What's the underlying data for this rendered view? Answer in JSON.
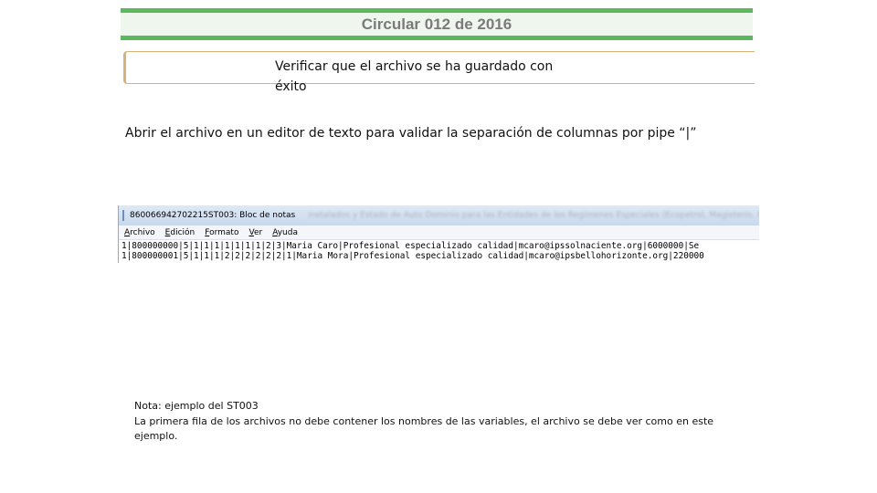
{
  "header": {
    "title": "Circular 012 de 2016"
  },
  "step": {
    "text": "Verificar que el archivo se ha guardado con éxito"
  },
  "instruction": {
    "text": "Abrir el archivo en un editor de texto para  validar la separación de columnas por pipe  “|”"
  },
  "notepad": {
    "window_title": "860066942702215ST003: Bloc de notas",
    "blurred_title": "instalados y Estado de Auto Dominio para las Entidades de los Regímenes Especiales (Ecopetrol, Magisterio, Fuerzas",
    "menu": [
      {
        "hotkey": "A",
        "rest": "rchivo"
      },
      {
        "hotkey": "E",
        "rest": "dición"
      },
      {
        "hotkey": "F",
        "rest": "ormato"
      },
      {
        "hotkey": "V",
        "rest": "er"
      },
      {
        "hotkey": "A",
        "rest": "yuda"
      }
    ],
    "lines": [
      "1|800000000|5|1|1|1|1|1|1|1|2|3|Maria Caro|Profesional especializado calidad|mcaro@ipssolnaciente.org|6000000|Se",
      "1|800000001|5|1|1|1|2|2|2|2|2|2|1|Maria Mora|Profesional especializado calidad|mcaro@ipsbellohorizonte.org|220000"
    ]
  },
  "note": {
    "line1": "Nota: ejemplo del ST003",
    "line2": "La primera fila de los archivos no debe contener los nombres de las variables, el archivo se debe ver como en este ejemplo."
  },
  "colors": {
    "banner_green": "#5cb85c",
    "step_border": "#d9b27a",
    "title_text": "#7a7a7a"
  }
}
